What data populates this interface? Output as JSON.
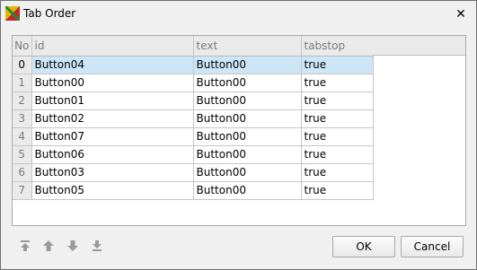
{
  "window": {
    "title": "Tab Order",
    "close_glyph": "✕",
    "icon": "app-logo-icon"
  },
  "table": {
    "columns": [
      "No",
      "id",
      "text",
      "tabstop"
    ],
    "rows": [
      {
        "no": "0",
        "id": "Button04",
        "text": "Button00",
        "tabstop": "true"
      },
      {
        "no": "1",
        "id": "Button00",
        "text": "Button00",
        "tabstop": "true"
      },
      {
        "no": "2",
        "id": "Button01",
        "text": "Button00",
        "tabstop": "true"
      },
      {
        "no": "3",
        "id": "Button02",
        "text": "Button00",
        "tabstop": "true"
      },
      {
        "no": "4",
        "id": "Button07",
        "text": "Button00",
        "tabstop": "true"
      },
      {
        "no": "5",
        "id": "Button06",
        "text": "Button00",
        "tabstop": "true"
      },
      {
        "no": "6",
        "id": "Button03",
        "text": "Button00",
        "tabstop": "true"
      },
      {
        "no": "7",
        "id": "Button05",
        "text": "Button00",
        "tabstop": "true"
      }
    ],
    "selected_row": 0
  },
  "nav_buttons": [
    "move-top-icon",
    "move-up-icon",
    "move-down-icon",
    "move-bottom-icon"
  ],
  "buttons": {
    "ok": "OK",
    "cancel": "Cancel"
  },
  "colors": {
    "selection": "#cce6f7",
    "header": "#eaeaea"
  }
}
